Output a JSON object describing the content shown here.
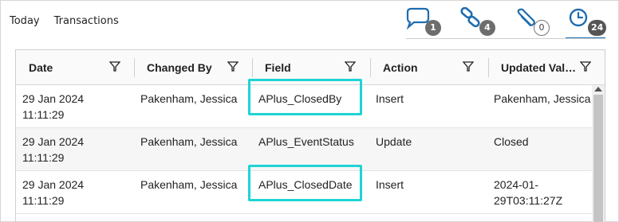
{
  "tabs": [
    "Today",
    "Transactions"
  ],
  "toolbar": {
    "comments_count": "1",
    "links_count": "4",
    "attachments_count": "0",
    "history_count": "24"
  },
  "grid": {
    "columns": [
      "Date",
      "Changed By",
      "Field",
      "Action",
      "Updated Val…"
    ],
    "rows": [
      {
        "date_line1": "29 Jan 2024",
        "date_line2": "11:11:29",
        "changed_by": "Pakenham, Jessica",
        "field": "APlus_ClosedBy",
        "action": "Insert",
        "updated_line1": "Pakenham, Jessica",
        "updated_line2": "",
        "highlighted": true
      },
      {
        "date_line1": "29 Jan 2024",
        "date_line2": "11:11:29",
        "changed_by": "Pakenham, Jessica",
        "field": "APlus_EventStatus",
        "action": "Update",
        "updated_line1": "Closed",
        "updated_line2": "",
        "highlighted": false
      },
      {
        "date_line1": "29 Jan 2024",
        "date_line2": "11:11:29",
        "changed_by": "Pakenham, Jessica",
        "field": "APlus_ClosedDate",
        "action": "Insert",
        "updated_line1": "2024-01-",
        "updated_line2": "29T03:11:27Z",
        "highlighted": true
      }
    ]
  },
  "colors": {
    "highlight": "#1fd4d4",
    "accent": "#1f6db0",
    "badge": "#6d6d6d"
  },
  "icons": [
    "comment-icon",
    "link-icon",
    "attachment-icon",
    "history-icon",
    "filter-icon"
  ]
}
